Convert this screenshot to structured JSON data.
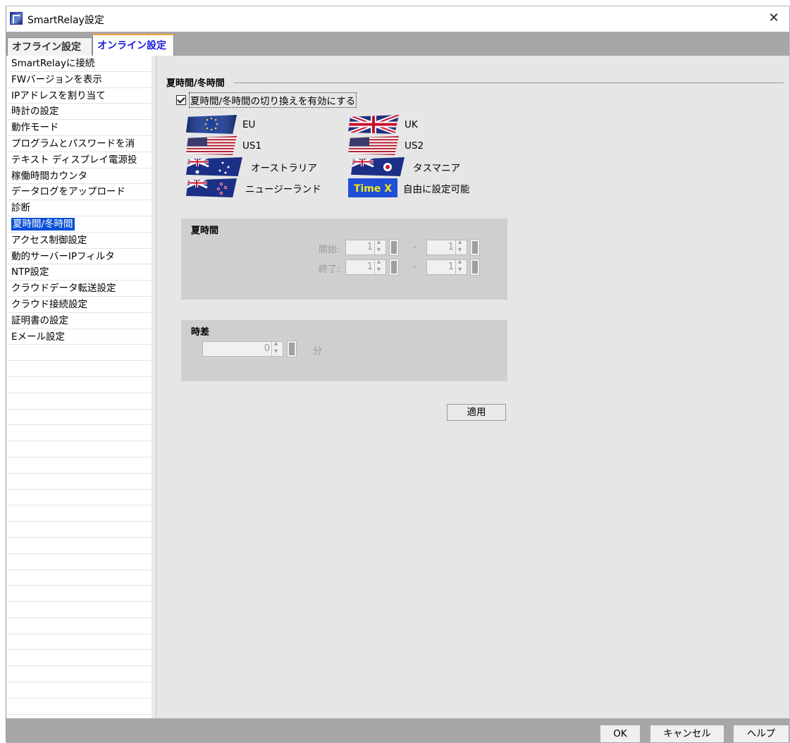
{
  "window": {
    "title": "SmartRelay設定",
    "close_symbol": "✕"
  },
  "tabs": [
    {
      "label": "オフライン設定",
      "active": false
    },
    {
      "label": "オンライン設定",
      "active": true
    }
  ],
  "sidebar": {
    "items": [
      "SmartRelayに接続",
      "FWバージョンを表示",
      "IPアドレスを割り当て",
      "時計の設定",
      "動作モード",
      "プログラムとパスワードを消",
      "テキスト ディスプレイ電源投",
      "稼働時間カウンタ",
      "データログをアップロード",
      "診断",
      "夏時間/冬時間",
      "アクセス制御設定",
      "動的サーバーIPフィルタ",
      "NTP設定",
      "クラウドデータ転送設定",
      "クラウド接続設定",
      "証明書の設定",
      "Eメール設定"
    ],
    "selected": "夏時間/冬時間"
  },
  "main": {
    "section_title": "夏時間/冬時間",
    "enable_checkbox": {
      "label": "夏時間/冬時間の切り換えを有効にする",
      "checked": true
    },
    "regions": [
      {
        "label": "EU",
        "flag": "eu-flag-icon"
      },
      {
        "label": "UK",
        "flag": "uk-flag-icon"
      },
      {
        "label": "US1",
        "flag": "us-flag-icon"
      },
      {
        "label": "US2",
        "flag": "us-flag-icon"
      },
      {
        "label": "オーストラリア",
        "flag": "australia-flag-icon"
      },
      {
        "label": "タスマニア",
        "flag": "tasmania-flag-icon"
      },
      {
        "label": "ニュージーランド",
        "flag": "new-zealand-flag-icon"
      },
      {
        "label": "自由に設定可能",
        "flag": "time-x-icon",
        "flag_text": "Time X"
      }
    ],
    "summer_time": {
      "title": "夏時間",
      "start_label": "開始:",
      "end_label": "終了:",
      "start_month": "1",
      "start_day": "1",
      "end_month": "1",
      "end_day": "1",
      "separator": "-"
    },
    "time_offset": {
      "title": "時差",
      "value": "0",
      "unit": "分"
    },
    "apply_label": "適用"
  },
  "footer": {
    "ok": "OK",
    "cancel": "キャンセル",
    "help": "ヘルプ"
  },
  "colors": {
    "selection": "#0a50d8",
    "active_tab_text": "#1a1adf",
    "tab_accent": "#f2a33a"
  }
}
